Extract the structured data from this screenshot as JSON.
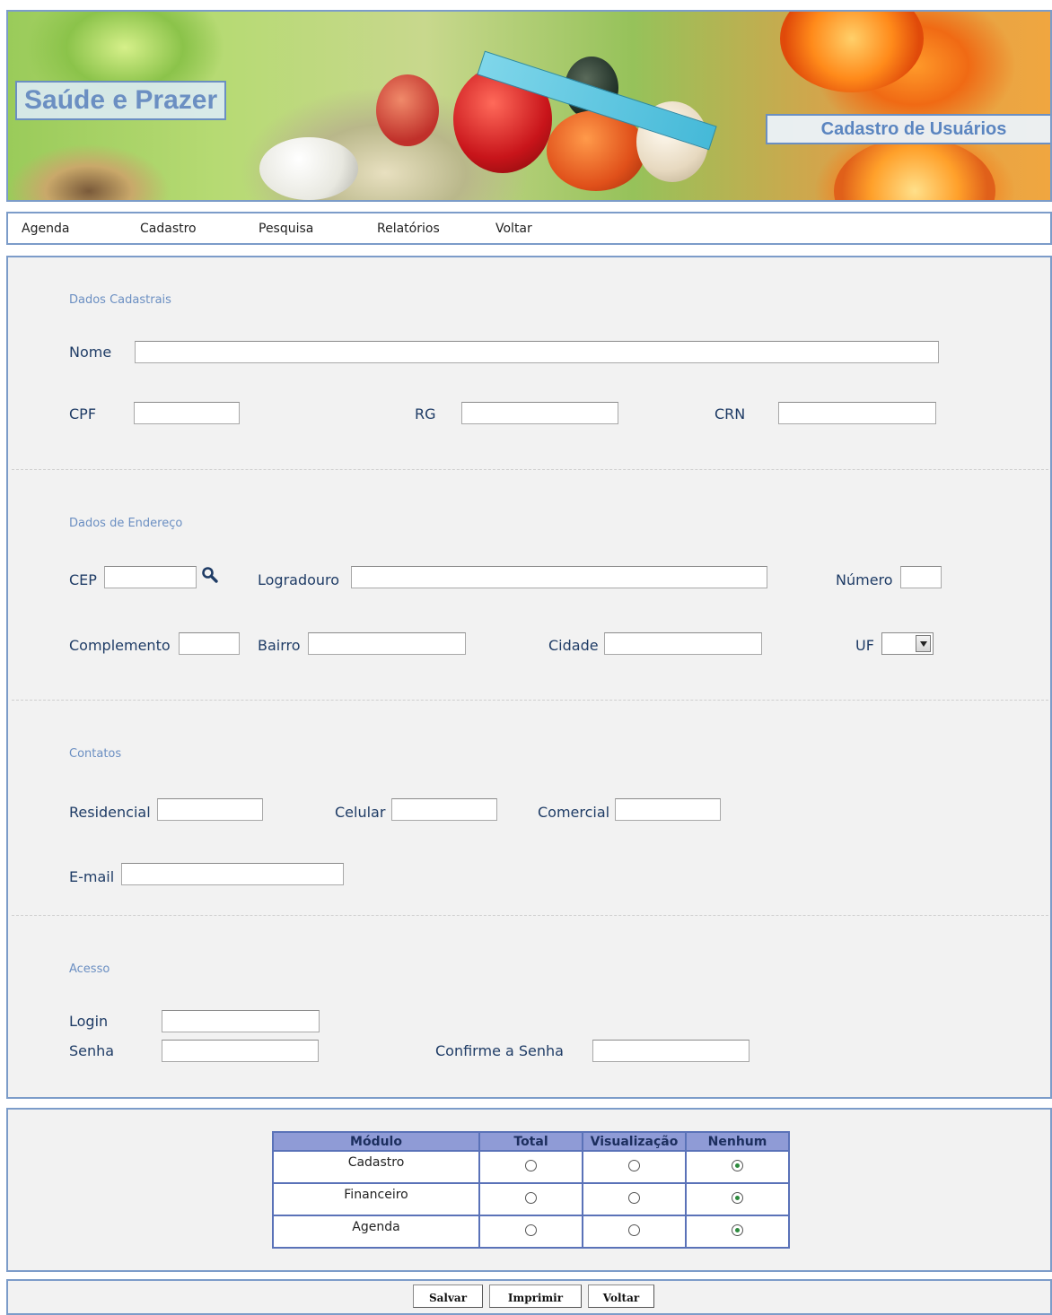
{
  "banner": {
    "site_title": "Saúde e Prazer",
    "page_title": "Cadastro de Usuários"
  },
  "menu": {
    "items": [
      "Agenda",
      "Cadastro",
      "Pesquisa",
      "Relatórios",
      "Voltar"
    ]
  },
  "sections": {
    "dados_cadastrais": {
      "title": "Dados Cadastrais",
      "nome_label": "Nome",
      "nome_value": "",
      "cpf_label": "CPF",
      "cpf_value": "",
      "rg_label": "RG",
      "rg_value": "",
      "crn_label": "CRN",
      "crn_value": ""
    },
    "endereco": {
      "title": "Dados de Endereço",
      "cep_label": "CEP",
      "cep_value": "",
      "logradouro_label": "Logradouro",
      "logradouro_value": "",
      "numero_label": "Número",
      "numero_value": "",
      "complemento_label": "Complemento",
      "complemento_value": "",
      "bairro_label": "Bairro",
      "bairro_value": "",
      "cidade_label": "Cidade",
      "cidade_value": "",
      "uf_label": "UF",
      "uf_value": ""
    },
    "contatos": {
      "title": "Contatos",
      "residencial_label": "Residencial",
      "residencial_value": "",
      "celular_label": "Celular",
      "celular_value": "",
      "comercial_label": "Comercial",
      "comercial_value": "",
      "email_label": "E-mail",
      "email_value": ""
    },
    "acesso": {
      "title": "Acesso",
      "login_label": "Login",
      "login_value": "",
      "senha_label": "Senha",
      "senha_value": "",
      "confirme_label": "Confirme a Senha",
      "confirme_value": ""
    }
  },
  "permissions": {
    "headers": [
      "Módulo",
      "Total",
      "Visualização",
      "Nenhum"
    ],
    "rows": [
      {
        "module": "Cadastro",
        "selected": "Nenhum"
      },
      {
        "module": "Financeiro",
        "selected": "Nenhum"
      },
      {
        "module": "Agenda",
        "selected": "Nenhum"
      }
    ]
  },
  "buttons": {
    "save": "Salvar",
    "print": "Imprimir",
    "back": "Voltar"
  },
  "icons": {
    "cep_search": "search-icon",
    "uf_dropdown": "chevron-down-icon"
  },
  "colors": {
    "accent": "#6b8fc2",
    "border": "#7c9cc9",
    "table_header": "#8f9bd6"
  }
}
